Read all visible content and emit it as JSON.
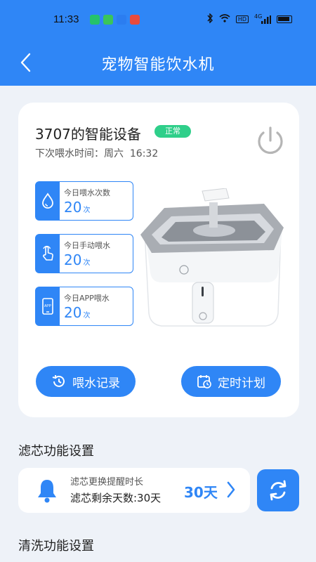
{
  "status_bar": {
    "time": "11:33",
    "network": "4G",
    "hd": "HD",
    "app_icons": [
      "messages-icon",
      "wechat-icon",
      "app-icon",
      "app-icon"
    ]
  },
  "header": {
    "title": "宠物智能饮水机",
    "back_icon": "chevron-left-icon",
    "color": "#2f86f6"
  },
  "device": {
    "name": "3707的智能设备",
    "status": "正常",
    "status_color": "#2fcf8a",
    "next_time_label": "下次喂水时间：",
    "next_time_value": "周六  16:32",
    "power_icon": "power-icon"
  },
  "stats": [
    {
      "label": "今日喂水次数",
      "value": "20",
      "unit": "次",
      "icon": "water-drop-icon"
    },
    {
      "label": "今日手动喂水",
      "value": "20",
      "unit": "次",
      "icon": "hand-tap-icon"
    },
    {
      "label": "今日APP喂水",
      "value": "20",
      "unit": "次",
      "icon": "phone-app-icon"
    }
  ],
  "actions": {
    "history_label": "喂水记录",
    "schedule_label": "定时计划"
  },
  "filter": {
    "section_title": "滤芯功能设置",
    "reminder_label": "滤芯更换提醒时长",
    "remaining_label": "滤芯剩余天数:30天",
    "days_value": "30天"
  },
  "cleaning": {
    "section_title": "清洗功能设置"
  }
}
